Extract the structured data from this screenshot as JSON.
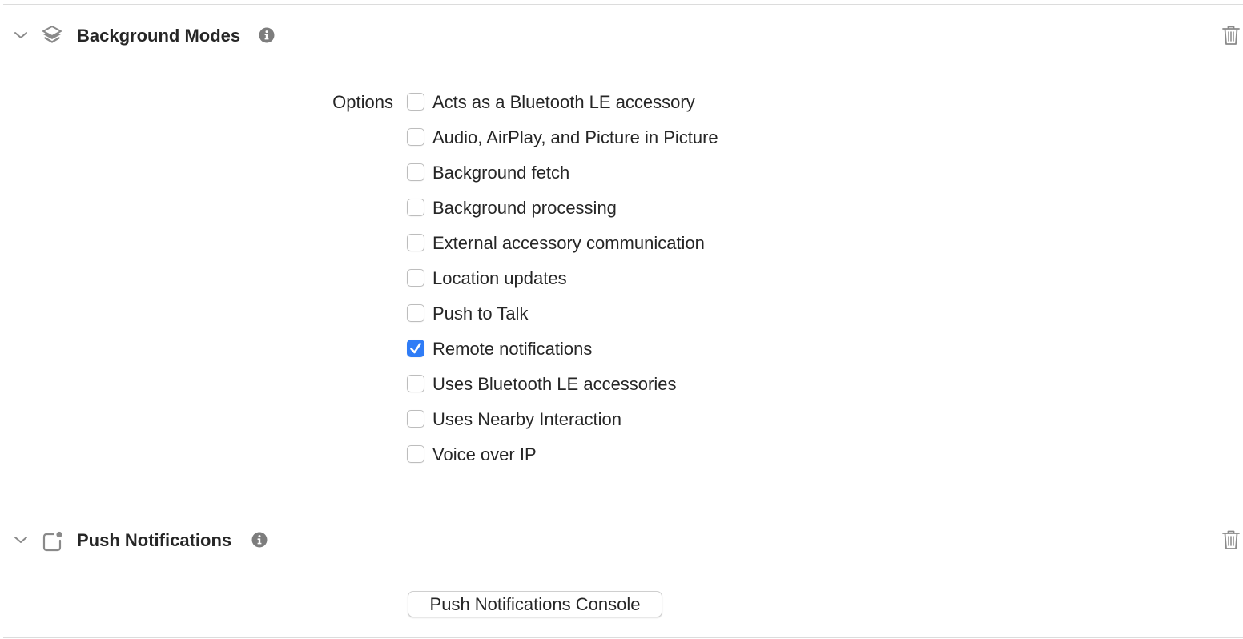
{
  "sections": {
    "background_modes": {
      "title": "Background Modes",
      "icon": "layers-icon",
      "options_label": "Options",
      "options": [
        {
          "label": "Acts as a Bluetooth LE accessory",
          "checked": false
        },
        {
          "label": "Audio, AirPlay, and Picture in Picture",
          "checked": false
        },
        {
          "label": "Background fetch",
          "checked": false
        },
        {
          "label": "Background processing",
          "checked": false
        },
        {
          "label": "External accessory communication",
          "checked": false
        },
        {
          "label": "Location updates",
          "checked": false
        },
        {
          "label": "Push to Talk",
          "checked": false
        },
        {
          "label": "Remote notifications",
          "checked": true
        },
        {
          "label": "Uses Bluetooth LE accessories",
          "checked": false
        },
        {
          "label": "Uses Nearby Interaction",
          "checked": false
        },
        {
          "label": "Voice over IP",
          "checked": false
        }
      ]
    },
    "push_notifications": {
      "title": "Push Notifications",
      "icon": "notification-badge-icon",
      "console_button_label": "Push Notifications Console"
    }
  },
  "colors": {
    "accent": "#2f7cf6",
    "text": "#262626",
    "icon_gray": "#8a8a8a",
    "divider": "#dcdcdc"
  }
}
